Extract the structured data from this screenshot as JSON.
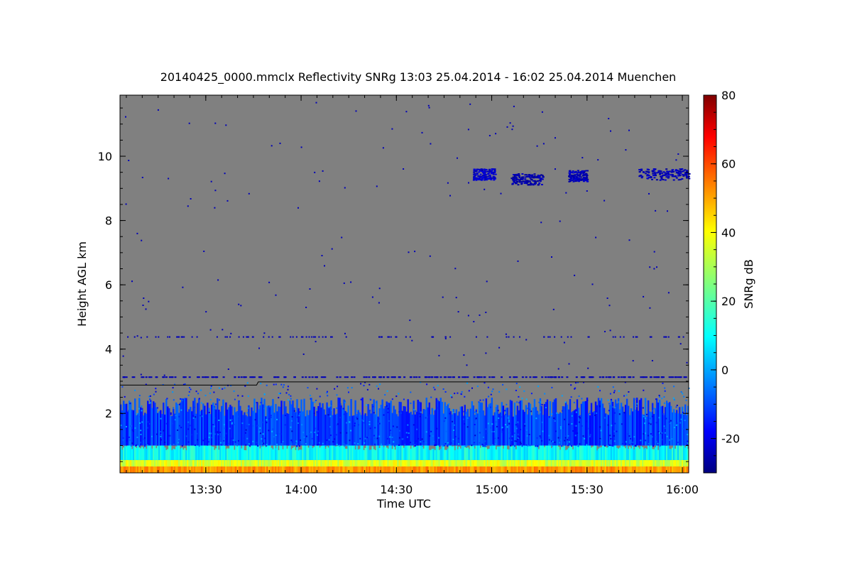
{
  "chart_data": {
    "type": "heatmap",
    "title": "20140425_0000.mmclx Reflectivity SNRg   13:03 25.04.2014 - 16:02 25.04.2014 Muenchen",
    "xlabel": "Time UTC",
    "ylabel": "Height AGL km",
    "colorbar_label": "SNRg dB",
    "x_range_min": [
      783,
      962
    ],
    "y_range_km": [
      0.15,
      11.9
    ],
    "x_ticks": [
      {
        "min": 810,
        "label": "13:30"
      },
      {
        "min": 840,
        "label": "14:00"
      },
      {
        "min": 870,
        "label": "14:30"
      },
      {
        "min": 900,
        "label": "15:00"
      },
      {
        "min": 930,
        "label": "15:30"
      },
      {
        "min": 960,
        "label": "16:00"
      }
    ],
    "y_ticks": [
      {
        "km": 2,
        "label": "2"
      },
      {
        "km": 4,
        "label": "4"
      },
      {
        "km": 6,
        "label": "6"
      },
      {
        "km": 8,
        "label": "8"
      },
      {
        "km": 10,
        "label": "10"
      }
    ],
    "colorbar_range_db": [
      -30,
      80
    ],
    "colorbar_ticks": [
      {
        "db": -20,
        "label": "-20"
      },
      {
        "db": 0,
        "label": "0"
      },
      {
        "db": 20,
        "label": "20"
      },
      {
        "db": 40,
        "label": "40"
      },
      {
        "db": 60,
        "label": "60"
      },
      {
        "db": 80,
        "label": "80"
      }
    ],
    "background_color": "#808080",
    "cloud_base_line": [
      {
        "min": 783,
        "km": 2.88
      },
      {
        "min": 826,
        "km": 2.88
      },
      {
        "min": 826.5,
        "km": 2.98
      },
      {
        "min": 962,
        "km": 2.98
      }
    ],
    "cirrus_patches": [
      {
        "t0": 894,
        "t1": 901,
        "h": 9.45,
        "db": -22
      },
      {
        "t0": 906,
        "t1": 916,
        "h": 9.3,
        "db": -25
      },
      {
        "t0": 924,
        "t1": 930,
        "h": 9.4,
        "db": -24
      },
      {
        "t0": 946,
        "t1": 962,
        "h": 9.45,
        "db": -24
      }
    ],
    "layers": [
      {
        "name": "surface",
        "h0": 0.15,
        "h1": 0.35,
        "db": 50
      },
      {
        "name": "near-surface",
        "h0": 0.35,
        "h1": 0.55,
        "db": 35
      },
      {
        "name": "boundary-layer",
        "h0": 0.55,
        "h1": 1.0,
        "db": 12
      },
      {
        "name": "upper boundary layer",
        "h0": 1.0,
        "h1": 2.2,
        "db": -10
      }
    ],
    "grid": false
  }
}
